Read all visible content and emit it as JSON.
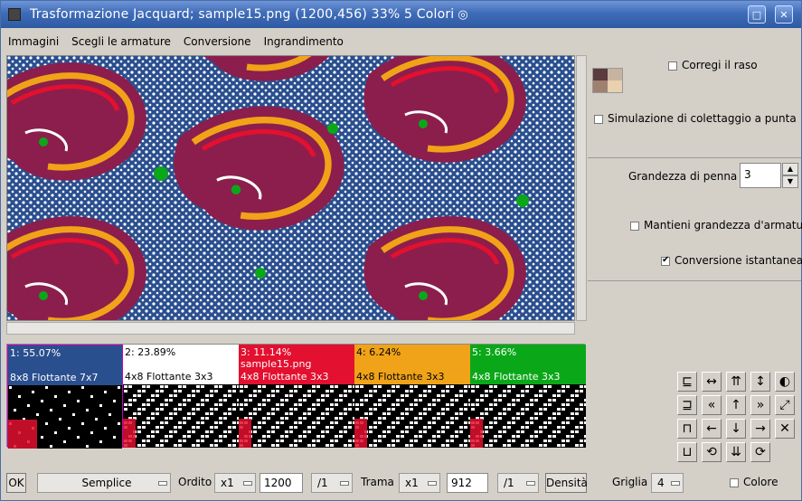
{
  "window": {
    "title": "Trasformazione Jacquard; sample15.png (1200,456) 33% 5 Colori",
    "minimize": "□",
    "close": "✕"
  },
  "menu": [
    "Immagini",
    "Scegli le armature",
    "Conversione",
    "Ingrandimento"
  ],
  "right_panel": {
    "correggi": "Corregi il raso",
    "simulazione": "Simulazione di colettaggio a punta",
    "grandezza_label": "Grandezza di penna",
    "grandezza_value": "3",
    "mantieni": "Mantieni grandezza d'armatur",
    "conversione": "Conversione istantanea"
  },
  "colors": [
    {
      "pct": "1: 55.07%",
      "file": "",
      "weave": "8x8 Flottante 7x7",
      "bg": "#2a4f8f",
      "fg": "#ffffff"
    },
    {
      "pct": "2: 23.89%",
      "file": "",
      "weave": "4x8 Flottante 3x3",
      "bg": "#ffffff",
      "fg": "#000000"
    },
    {
      "pct": "3: 11.14%",
      "file": "sample15.png",
      "weave": "4x8 Flottante 3x3",
      "bg": "#e3102f",
      "fg": "#ffffff"
    },
    {
      "pct": "4: 6.24%",
      "file": "",
      "weave": "4x8 Flottante 3x3",
      "bg": "#f0a318",
      "fg": "#000000"
    },
    {
      "pct": "5: 3.66%",
      "file": "",
      "weave": "4x8 Flottante 3x3",
      "bg": "#0aa818",
      "fg": "#ffffff"
    }
  ],
  "bottom": {
    "ok": "OK",
    "mode": "Semplice",
    "ordito": "Ordito",
    "ordito_mult": "x1",
    "ordito_val": "1200",
    "ordito_div": "/1",
    "trama": "Trama",
    "trama_mult": "x1",
    "trama_val": "912",
    "trama_div": "/1",
    "densita": "Densità",
    "griglia": "Griglia",
    "griglia_val": "4",
    "colore": "Colore"
  },
  "palette": {
    "navy": "#2a4f8f",
    "red": "#e3102f",
    "orange": "#f0a318",
    "green": "#0aa818",
    "maroon": "#8b1e4c",
    "accent": "#3f6cb8"
  }
}
